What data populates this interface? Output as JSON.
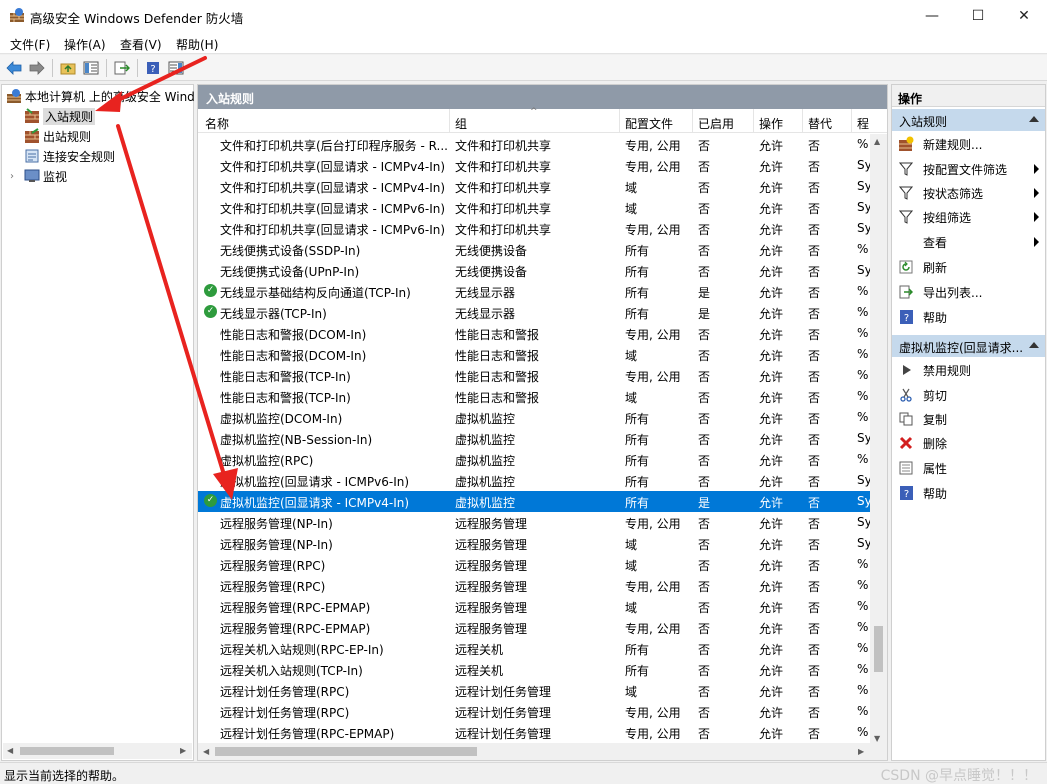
{
  "window": {
    "title": "高级安全 Windows Defender 防火墙",
    "minimize_glyph": "—",
    "maximize_glyph": "☐",
    "close_glyph": "✕"
  },
  "menu": [
    "文件(F)",
    "操作(A)",
    "查看(V)",
    "帮助(H)"
  ],
  "tree": {
    "root": "本地计算机 上的高级安全 Wind",
    "items": [
      "入站规则",
      "出站规则",
      "连接安全规则",
      "监视"
    ]
  },
  "center": {
    "header": "入站规则",
    "columns": [
      "名称",
      "组",
      "配置文件",
      "已启用",
      "操作",
      "替代",
      "程"
    ],
    "rows": [
      {
        "name": "文件和打印机共享(后台打印程序服务 - R...",
        "group": "文件和打印机共享",
        "profile": "专用, 公用",
        "enabled": "否",
        "action": "允许",
        "override": "否",
        "program": "%",
        "check": false
      },
      {
        "name": "文件和打印机共享(回显请求 - ICMPv4-In)",
        "group": "文件和打印机共享",
        "profile": "专用, 公用",
        "enabled": "否",
        "action": "允许",
        "override": "否",
        "program": "Sy",
        "check": false
      },
      {
        "name": "文件和打印机共享(回显请求 - ICMPv4-In)",
        "group": "文件和打印机共享",
        "profile": "域",
        "enabled": "否",
        "action": "允许",
        "override": "否",
        "program": "Sy",
        "check": false
      },
      {
        "name": "文件和打印机共享(回显请求 - ICMPv6-In)",
        "group": "文件和打印机共享",
        "profile": "域",
        "enabled": "否",
        "action": "允许",
        "override": "否",
        "program": "Sy",
        "check": false
      },
      {
        "name": "文件和打印机共享(回显请求 - ICMPv6-In)",
        "group": "文件和打印机共享",
        "profile": "专用, 公用",
        "enabled": "否",
        "action": "允许",
        "override": "否",
        "program": "Sy",
        "check": false
      },
      {
        "name": "无线便携式设备(SSDP-In)",
        "group": "无线便携设备",
        "profile": "所有",
        "enabled": "否",
        "action": "允许",
        "override": "否",
        "program": "%",
        "check": false
      },
      {
        "name": "无线便携式设备(UPnP-In)",
        "group": "无线便携设备",
        "profile": "所有",
        "enabled": "否",
        "action": "允许",
        "override": "否",
        "program": "Sy",
        "check": false
      },
      {
        "name": "无线显示基础结构反向通道(TCP-In)",
        "group": "无线显示器",
        "profile": "所有",
        "enabled": "是",
        "action": "允许",
        "override": "否",
        "program": "%",
        "check": true
      },
      {
        "name": "无线显示器(TCP-In)",
        "group": "无线显示器",
        "profile": "所有",
        "enabled": "是",
        "action": "允许",
        "override": "否",
        "program": "%",
        "check": true
      },
      {
        "name": "性能日志和警报(DCOM-In)",
        "group": "性能日志和警报",
        "profile": "专用, 公用",
        "enabled": "否",
        "action": "允许",
        "override": "否",
        "program": "%",
        "check": false
      },
      {
        "name": "性能日志和警报(DCOM-In)",
        "group": "性能日志和警报",
        "profile": "域",
        "enabled": "否",
        "action": "允许",
        "override": "否",
        "program": "%",
        "check": false
      },
      {
        "name": "性能日志和警报(TCP-In)",
        "group": "性能日志和警报",
        "profile": "专用, 公用",
        "enabled": "否",
        "action": "允许",
        "override": "否",
        "program": "%",
        "check": false
      },
      {
        "name": "性能日志和警报(TCP-In)",
        "group": "性能日志和警报",
        "profile": "域",
        "enabled": "否",
        "action": "允许",
        "override": "否",
        "program": "%",
        "check": false
      },
      {
        "name": "虚拟机监控(DCOM-In)",
        "group": "虚拟机监控",
        "profile": "所有",
        "enabled": "否",
        "action": "允许",
        "override": "否",
        "program": "%",
        "check": false
      },
      {
        "name": "虚拟机监控(NB-Session-In)",
        "group": "虚拟机监控",
        "profile": "所有",
        "enabled": "否",
        "action": "允许",
        "override": "否",
        "program": "Sy",
        "check": false
      },
      {
        "name": "虚拟机监控(RPC)",
        "group": "虚拟机监控",
        "profile": "所有",
        "enabled": "否",
        "action": "允许",
        "override": "否",
        "program": "%",
        "check": false
      },
      {
        "name": "虚拟机监控(回显请求 - ICMPv6-In)",
        "group": "虚拟机监控",
        "profile": "所有",
        "enabled": "否",
        "action": "允许",
        "override": "否",
        "program": "Sy",
        "check": false
      },
      {
        "name": "虚拟机监控(回显请求 - ICMPv4-In)",
        "group": "虚拟机监控",
        "profile": "所有",
        "enabled": "是",
        "action": "允许",
        "override": "否",
        "program": "Sy",
        "check": true,
        "selected": true
      },
      {
        "name": "远程服务管理(NP-In)",
        "group": "远程服务管理",
        "profile": "专用, 公用",
        "enabled": "否",
        "action": "允许",
        "override": "否",
        "program": "Sy",
        "check": false
      },
      {
        "name": "远程服务管理(NP-In)",
        "group": "远程服务管理",
        "profile": "域",
        "enabled": "否",
        "action": "允许",
        "override": "否",
        "program": "Sy",
        "check": false
      },
      {
        "name": "远程服务管理(RPC)",
        "group": "远程服务管理",
        "profile": "域",
        "enabled": "否",
        "action": "允许",
        "override": "否",
        "program": "%",
        "check": false
      },
      {
        "name": "远程服务管理(RPC)",
        "group": "远程服务管理",
        "profile": "专用, 公用",
        "enabled": "否",
        "action": "允许",
        "override": "否",
        "program": "%",
        "check": false
      },
      {
        "name": "远程服务管理(RPC-EPMAP)",
        "group": "远程服务管理",
        "profile": "域",
        "enabled": "否",
        "action": "允许",
        "override": "否",
        "program": "%",
        "check": false
      },
      {
        "name": "远程服务管理(RPC-EPMAP)",
        "group": "远程服务管理",
        "profile": "专用, 公用",
        "enabled": "否",
        "action": "允许",
        "override": "否",
        "program": "%",
        "check": false
      },
      {
        "name": "远程关机入站规则(RPC-EP-In)",
        "group": "远程关机",
        "profile": "所有",
        "enabled": "否",
        "action": "允许",
        "override": "否",
        "program": "%",
        "check": false
      },
      {
        "name": "远程关机入站规则(TCP-In)",
        "group": "远程关机",
        "profile": "所有",
        "enabled": "否",
        "action": "允许",
        "override": "否",
        "program": "%",
        "check": false
      },
      {
        "name": "远程计划任务管理(RPC)",
        "group": "远程计划任务管理",
        "profile": "域",
        "enabled": "否",
        "action": "允许",
        "override": "否",
        "program": "%",
        "check": false
      },
      {
        "name": "远程计划任务管理(RPC)",
        "group": "远程计划任务管理",
        "profile": "专用, 公用",
        "enabled": "否",
        "action": "允许",
        "override": "否",
        "program": "%",
        "check": false
      },
      {
        "name": "远程计划任务管理(RPC-EPMAP)",
        "group": "远程计划任务管理",
        "profile": "专用, 公用",
        "enabled": "否",
        "action": "允许",
        "override": "否",
        "program": "%",
        "check": false
      }
    ]
  },
  "actions": {
    "title": "操作",
    "section1": "入站规则",
    "section1_items": [
      "新建规则...",
      "按配置文件筛选",
      "按状态筛选",
      "按组筛选",
      "查看",
      "刷新",
      "导出列表...",
      "帮助"
    ],
    "section2": "虚拟机监控(回显请求...",
    "section2_items": [
      "禁用规则",
      "剪切",
      "复制",
      "删除",
      "属性",
      "帮助"
    ]
  },
  "status": {
    "text": "显示当前选择的帮助。",
    "watermark": "CSDN @早点睡觉！！！"
  },
  "colors": {
    "selection": "#0078d7",
    "pane_header": "#8f9aa8",
    "section_header": "#c5d9ec",
    "annotation_arrow": "#e8231f"
  }
}
